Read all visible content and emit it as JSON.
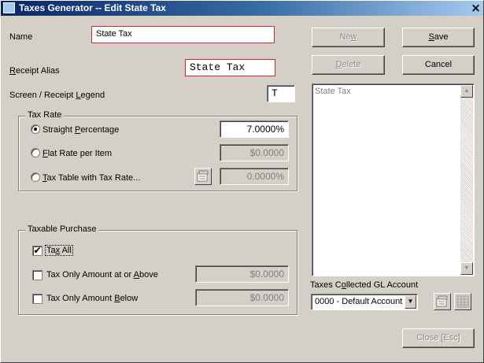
{
  "window": {
    "title": "Taxes Generator -- Edit State Tax",
    "close_glyph": "×"
  },
  "form": {
    "name_label": "Name",
    "name_value": "State Tax",
    "receipt_alias_label_pre": "",
    "receipt_alias_label_u": "R",
    "receipt_alias_label_post": "eceipt Alias",
    "receipt_alias_value": "State Tax",
    "legend_label_pre": "Screen / Receipt ",
    "legend_label_u": "L",
    "legend_label_post": "egend",
    "legend_value": "T"
  },
  "tax_rate": {
    "group_label": "Tax Rate",
    "straight_pre": "Straight ",
    "straight_u": "P",
    "straight_post": "ercentage",
    "straight_value": "7.0000%",
    "flat_u": "F",
    "flat_post": "lat Rate per Item",
    "flat_value": "$0.0000",
    "table_u": "T",
    "table_post": "ax Table with Tax Rate...",
    "table_value": "0.0000%",
    "selected": "straight"
  },
  "taxable_purchase": {
    "group_label": "Taxable Purchase",
    "tax_all_pre": "Ta",
    "tax_all_u": "x",
    "tax_all_post": " All",
    "tax_all_checked": true,
    "above_pre": "Tax Only Amount at or ",
    "above_u": "A",
    "above_post": "bove",
    "above_value": "$0.0000",
    "above_checked": false,
    "below_pre": "Tax Only Amount ",
    "below_u": "B",
    "below_post": "elow",
    "below_value": "$0.0000",
    "below_checked": false,
    "check_glyph": "✔"
  },
  "buttons": {
    "new_pre": "Ne",
    "new_u": "w",
    "save_u": "S",
    "save_post": "ave",
    "delete_u": "D",
    "delete_post": "elete",
    "cancel": "Cancel",
    "close": "Close [Esc]"
  },
  "tax_list": {
    "items": [
      "State Tax"
    ],
    "scroll_up_glyph": "▲",
    "scroll_down_glyph": "▼"
  },
  "gl_account": {
    "label_pre": "Taxes C",
    "label_u": "o",
    "label_post": "llected GL Account",
    "selected": "0000 - Default Account - ",
    "dropdown_glyph": "▼"
  },
  "icons": {
    "tax_table_properties": "properties-icon",
    "gl_properties": "properties-icon",
    "gl_browse": "grid-lookup-icon"
  }
}
